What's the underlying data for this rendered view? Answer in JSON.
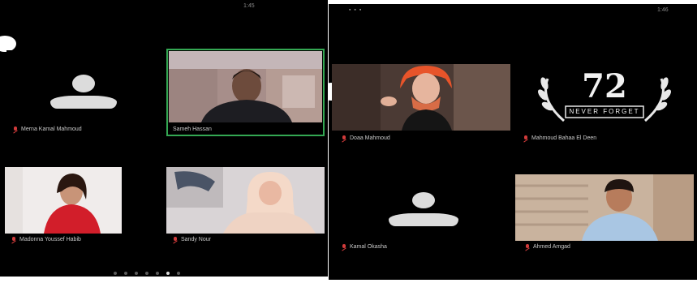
{
  "left_screen": {
    "status_time": "1:45",
    "participants": [
      {
        "name": "Merna Kamal Mahmoud",
        "video": "off"
      },
      {
        "name": "Sameh Hassan",
        "video": "on",
        "active_speaker": true
      },
      {
        "name": "Madonna Youssef Habib",
        "video": "on"
      },
      {
        "name": "Sandy Nour",
        "video": "on"
      }
    ],
    "pages": 7,
    "current_page": 6
  },
  "right_screen": {
    "status_time": "1:46",
    "participants": [
      {
        "name": "Doaa Mahmoud",
        "video": "on"
      },
      {
        "name": "Mahmoud Bahaa El Deen",
        "video": "on"
      },
      {
        "name": "Kamal Okasha",
        "video": "off"
      },
      {
        "name": "Ahmed Amgad",
        "video": "on"
      }
    ],
    "profile_badge": {
      "number": "72",
      "caption": "NEVER FORGET"
    }
  },
  "colors": {
    "background": "#000000",
    "active_border": "#34a853",
    "muted_mic": "#d23b3b",
    "name_text": "#c9c9c9",
    "avatar": "#dcdcdc"
  },
  "icons": [
    "app-logo-icon",
    "mic-off-icon",
    "avatar-placeholder-icon"
  ]
}
